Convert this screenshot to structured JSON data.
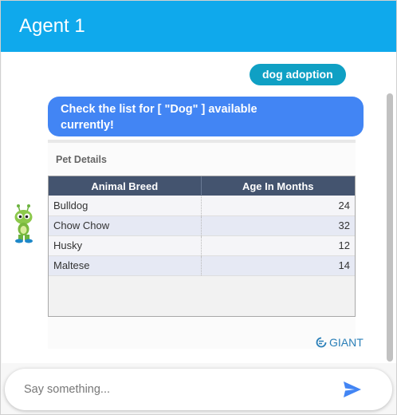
{
  "header": {
    "title": "Agent 1"
  },
  "chat": {
    "user_message": "dog adoption",
    "bot_message": "Check the list for [ \"Dog\" ] available currently!"
  },
  "card": {
    "title": "Pet Details",
    "columns": [
      "Animal Breed",
      "Age In Months"
    ],
    "rows": [
      {
        "breed": "Bulldog",
        "age": "24"
      },
      {
        "breed": "Chow Chow",
        "age": "32"
      },
      {
        "breed": "Husky",
        "age": "12"
      },
      {
        "breed": "Maltese",
        "age": "14"
      }
    ]
  },
  "branding": {
    "label": "GIANT",
    "icon": "giant-logo-icon"
  },
  "composer": {
    "placeholder": "Say something...",
    "value": "",
    "send_icon": "send-icon"
  },
  "colors": {
    "header": "#0fa9ec",
    "user_chip": "#0fa0c4",
    "bot_bubble": "#4285f4",
    "table_header": "#44546f",
    "send": "#4285f4"
  }
}
